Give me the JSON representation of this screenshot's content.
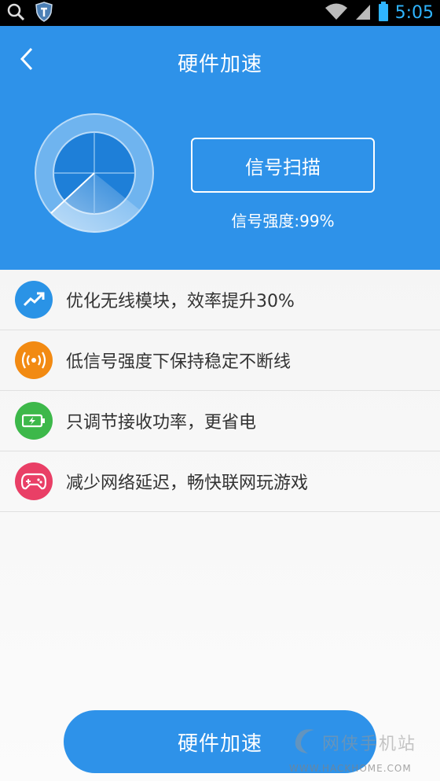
{
  "status_bar": {
    "time": "5:05",
    "icons": [
      "search-icon",
      "shield-app-icon",
      "wifi-icon",
      "cell-signal-icon",
      "battery-icon"
    ]
  },
  "header": {
    "title": "硬件加速",
    "back_icon": "back-chevron-icon",
    "scan_button_label": "信号扫描",
    "signal_strength_text": "信号强度:99%",
    "background_color": "#2e92e9"
  },
  "features": [
    {
      "icon": "trend-up-icon",
      "color": "#2a93e6",
      "text": "优化无线模块，效率提升30%"
    },
    {
      "icon": "signal-waves-icon",
      "color": "#f28a12",
      "text": "低信号强度下保持稳定不断线"
    },
    {
      "icon": "battery-charging-icon",
      "color": "#3db84a",
      "text": "只调节接收功率，更省电"
    },
    {
      "icon": "gamepad-icon",
      "color": "#e93f66",
      "text": "减少网络延迟，畅快联网玩游戏"
    }
  ],
  "footer": {
    "button_label": "硬件加速"
  },
  "watermark": {
    "title": "网侠手机站",
    "url": "WWW.HACKHOME.COM"
  }
}
